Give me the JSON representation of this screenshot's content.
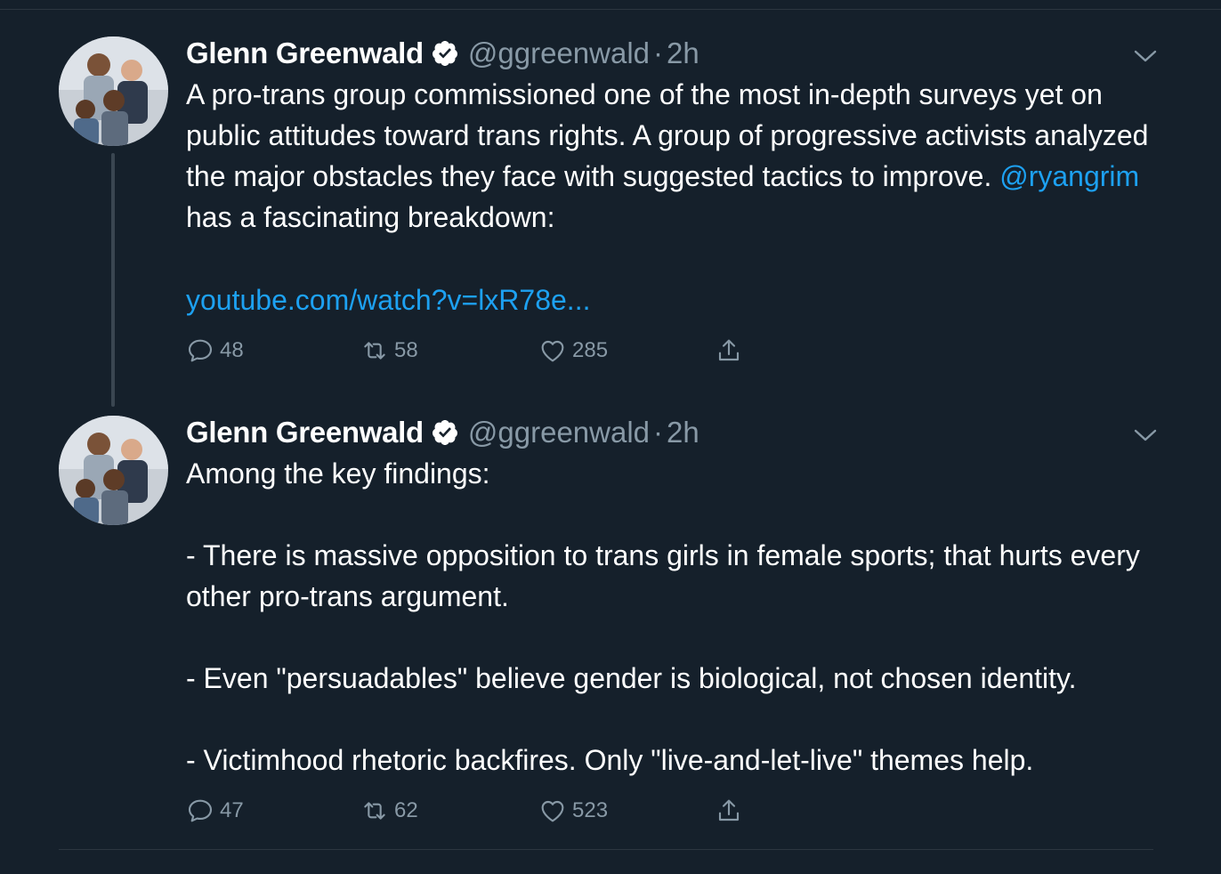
{
  "tweets": [
    {
      "author": {
        "name": "Glenn Greenwald",
        "handle": "@ggreenwald",
        "separator": "·",
        "time": "2h"
      },
      "text_before_mention": "A pro-trans group commissioned one of the most in-depth surveys yet on public attitudes toward trans rights. A group of progressive activists analyzed the major obstacles they face with suggested tactics to improve. ",
      "mention": "@ryangrim",
      "text_after_mention": " has a fascinating breakdown:",
      "link": "youtube.com/watch?v=lxR78e...",
      "stats": {
        "replies": "48",
        "retweets": "58",
        "likes": "285"
      }
    },
    {
      "author": {
        "name": "Glenn Greenwald",
        "handle": "@ggreenwald",
        "separator": "·",
        "time": "2h"
      },
      "text": "Among the key findings:\n\n- There is massive opposition to trans girls in female sports; that hurts every other pro-trans argument.\n\n- Even \"persuadables\" believe gender is biological, not chosen identity.\n\n- Victimhood rhetoric backfires. Only \"live-and-let-live\" themes help.",
      "stats": {
        "replies": "47",
        "retweets": "62",
        "likes": "523"
      }
    }
  ],
  "icons": {
    "verified": "verified-badge-icon",
    "caret": "chevron-down-icon",
    "reply": "reply-icon",
    "retweet": "retweet-icon",
    "like": "heart-icon",
    "share": "share-icon"
  },
  "colors": {
    "background": "#15202b",
    "accent": "#1da1f2",
    "secondary_text": "#8899a6"
  }
}
